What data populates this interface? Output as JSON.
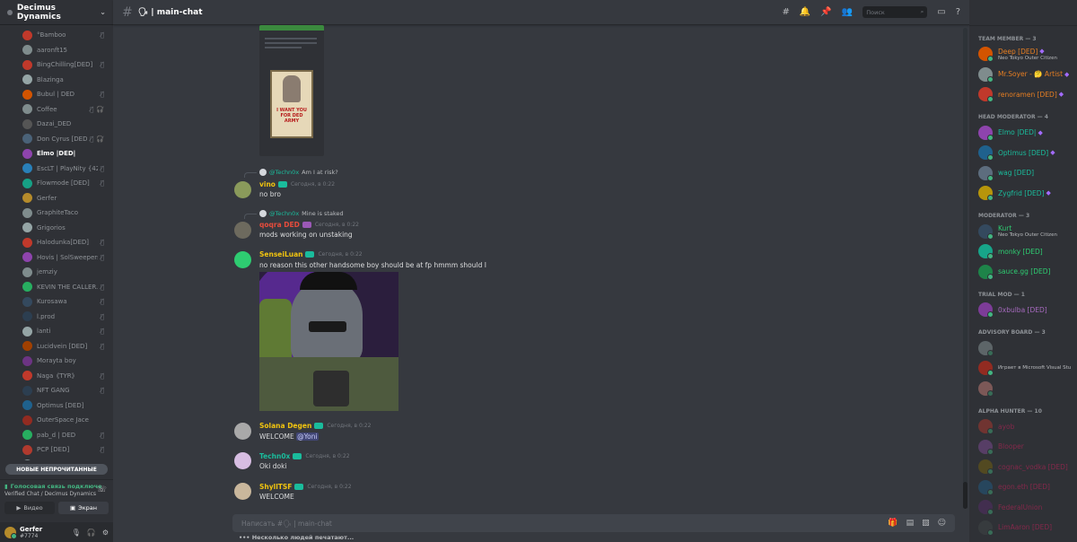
{
  "server": {
    "name": "Decimus Dynamics"
  },
  "voice_users": [
    {
      "name": "°Bamboo",
      "color": "#c0392b",
      "status": "mute"
    },
    {
      "name": "aaronft15",
      "color": "#7f8c8d",
      "status": ""
    },
    {
      "name": "BingChilling[DED]",
      "color": "#c0392b",
      "status": "mute"
    },
    {
      "name": "Blazinga",
      "color": "#95a5a6",
      "status": ""
    },
    {
      "name": "Bubul | DED",
      "color": "#d35400",
      "status": "mute"
    },
    {
      "name": "Coffee",
      "color": "#7f8c8d",
      "status": "mute deaf"
    },
    {
      "name": "Dazai_DED",
      "color": "#555",
      "status": ""
    },
    {
      "name": "Don Cyrus [DED]",
      "color": "#4a6278",
      "status": "mute deaf"
    },
    {
      "name": "Elmo |DED|",
      "color": "#8e44ad",
      "status": "",
      "selected": true
    },
    {
      "name": "EscLT | PlayNity {42...",
      "color": "#2980b9",
      "status": "mute"
    },
    {
      "name": "Flowmode [DED]",
      "color": "#16a085",
      "status": "mute"
    },
    {
      "name": "Gerfer",
      "color": "#b58b2b",
      "status": ""
    },
    {
      "name": "GraphiteTaco",
      "color": "#7f8c8d",
      "status": ""
    },
    {
      "name": "Grigorios",
      "color": "#95a5a6",
      "status": ""
    },
    {
      "name": "Halodunka[DED]",
      "color": "#c0392b",
      "status": "mute"
    },
    {
      "name": "Hovis | SolSweepers...",
      "color": "#8e44ad",
      "status": "mute"
    },
    {
      "name": "jemziy",
      "color": "#7f8c8d",
      "status": ""
    },
    {
      "name": "KEVIN THE CALLER...",
      "color": "#27ae60",
      "status": "mute"
    },
    {
      "name": "Kurosawa",
      "color": "#34495e",
      "status": "mute"
    },
    {
      "name": "l.prod",
      "color": "#2c3e50",
      "status": "mute"
    },
    {
      "name": "lanti",
      "color": "#95a5a6",
      "status": "mute"
    },
    {
      "name": "Lucidvein [DED]",
      "color": "#a04000",
      "status": "mute"
    },
    {
      "name": "Morayta boy",
      "color": "#6c3483",
      "status": ""
    },
    {
      "name": "Naga《TYR》",
      "color": "#c0392b",
      "status": "mute"
    },
    {
      "name": "NFT GANG",
      "color": "#2c3e50",
      "status": "mute"
    },
    {
      "name": "Optimus [DED]",
      "color": "#1f618d",
      "status": ""
    },
    {
      "name": "OuterSpace Jace",
      "color": "#922b21",
      "status": ""
    },
    {
      "name": "pab_d | DED",
      "color": "#27ae60",
      "status": "mute"
    },
    {
      "name": "PCP [DED]",
      "color": "#b03a2e",
      "status": "mute"
    },
    {
      "name": "PiterDeVries",
      "color": "#7f8c8d",
      "status": ""
    }
  ],
  "unread_label": "НОВЫЕ НЕПРОЧИТАННЫЕ",
  "voice_panel": {
    "status": "Голосовая связь подключе",
    "channel": "Verified Chat / Decimus Dynamics",
    "video_label": "Видео",
    "screen_label": "Экран"
  },
  "user": {
    "name": "Gerfer",
    "tag": "#7774"
  },
  "channel": {
    "name": "🗣 | main-chat"
  },
  "search": {
    "placeholder": "Поиск"
  },
  "messages": [
    {
      "author": "vino",
      "author_color": "#f1c40f",
      "badge": "#1abc9c",
      "time": "Сегодня, в 0:22",
      "reply_to": "@Techn0x",
      "reply_text": "Am I at risk?",
      "text": "no bro",
      "avatar": "#8a9a5b"
    },
    {
      "author": "qoqra DED",
      "author_color": "#e74c3c",
      "badge": "#9b59b6",
      "time": "Сегодня, в 0:22",
      "reply_to": "@Techn0x",
      "reply_text": "Mine is staked",
      "text": "mods working on unstaking",
      "avatar": "#6d6a5e"
    },
    {
      "author": "SenseiLuan",
      "author_color": "#f1c40f",
      "badge": "#1abc9c",
      "time": "Сегодня, в 0:22",
      "text": "no reason this other handsome boy should be at fp hmmm should I",
      "avatar": "#2ecc71"
    },
    {
      "author": "Solana Degen",
      "author_color": "#f1c40f",
      "badge": "#1abc9c",
      "time": "Сегодня, в 0:22",
      "text": "WELCOME",
      "mention": "@Yoni",
      "avatar": "#a9a9a9"
    },
    {
      "author": "Techn0x",
      "author_color": "#1abc9c",
      "badge": "#1abc9c",
      "time": "Сегодня, в 0:22",
      "text": "Oki doki",
      "avatar": "#d7bde2"
    },
    {
      "author": "ShyllTSF",
      "author_color": "#f1c40f",
      "badge": "#1abc9c",
      "time": "Сегодня, в 0:22",
      "text": "WELCOME",
      "avatar": "#c9b79c"
    }
  ],
  "embed_poster": {
    "line1": "I WANT YOU",
    "line2": "FOR DED ARMY"
  },
  "composer": {
    "placeholder": "Написать #🗣 | main-chat"
  },
  "typing": "Несколько людей печатают...",
  "member_groups": [
    {
      "title": "TEAM MEMBER — 3",
      "members": [
        {
          "name": "Deep [DED]",
          "color": "#e67e22",
          "sub": "Neo Tokyo Outer Citizen",
          "gem": true,
          "avatar": "#d35400"
        },
        {
          "name": "Mr.Soyer - 🤔 Artist",
          "color": "#e67e22",
          "gem": true,
          "avatar": "#7f8c8d"
        },
        {
          "name": "renoramen [DED]",
          "color": "#e67e22",
          "gem": true,
          "avatar": "#c0392b"
        }
      ]
    },
    {
      "title": "HEAD MODERATOR — 4",
      "members": [
        {
          "name": "Elmo |DED|",
          "color": "#1abc9c",
          "gem": true,
          "avatar": "#8e44ad"
        },
        {
          "name": "Optimus [DED]",
          "color": "#1abc9c",
          "gem": true,
          "avatar": "#1f618d"
        },
        {
          "name": "wag [DED]",
          "color": "#1abc9c",
          "avatar": "#5d6d7e"
        },
        {
          "name": "Zygfrid [DED]",
          "color": "#1abc9c",
          "gem": true,
          "avatar": "#b7950b"
        }
      ]
    },
    {
      "title": "MODERATOR — 3",
      "members": [
        {
          "name": "Kurt",
          "color": "#2ecc71",
          "sub": "Neo Tokyo Outer Citizen",
          "avatar": "#34495e"
        },
        {
          "name": "monky [DED]",
          "color": "#2ecc71",
          "avatar": "#17a589"
        },
        {
          "name": "sauce.gg [DED]",
          "color": "#2ecc71",
          "avatar": "#1e8449"
        }
      ]
    },
    {
      "title": "TRIAL MOD — 1",
      "members": [
        {
          "name": "0xbulba [DED]",
          "color": "#a569bd",
          "avatar": "#7d3c98"
        }
      ]
    },
    {
      "title": "ADVISORY BOARD — 3",
      "members": [
        {
          "name": "",
          "color": "#e74c3c",
          "avatar": "#95a5a6",
          "dim": true
        },
        {
          "name": "",
          "color": "#e74c3c",
          "sub": "Играет в Microsoft Visual Stu",
          "avatar": "#922b21"
        },
        {
          "name": "",
          "color": "#e74c3c",
          "avatar": "#d98880",
          "dim": true
        }
      ]
    },
    {
      "title": "ALPHA HUNTER — 10",
      "members": [
        {
          "name": "ayob",
          "color": "#e91e63",
          "avatar": "#c0392b",
          "dim": true
        },
        {
          "name": "Blooper",
          "color": "#e91e63",
          "avatar": "#884ea0",
          "dim": true
        },
        {
          "name": "cognac_vodka [DED]",
          "color": "#e91e63",
          "avatar": "#7d6608",
          "dim": true
        },
        {
          "name": "egon.eth [DED]",
          "color": "#e91e63",
          "avatar": "#1f618d",
          "dim": true
        },
        {
          "name": "FederalUnion",
          "color": "#e91e63",
          "avatar": "#5b2c6f",
          "dim": true
        },
        {
          "name": "LimAaron [DED]",
          "color": "#e91e63",
          "avatar": "#424949",
          "dim": true
        }
      ]
    }
  ]
}
